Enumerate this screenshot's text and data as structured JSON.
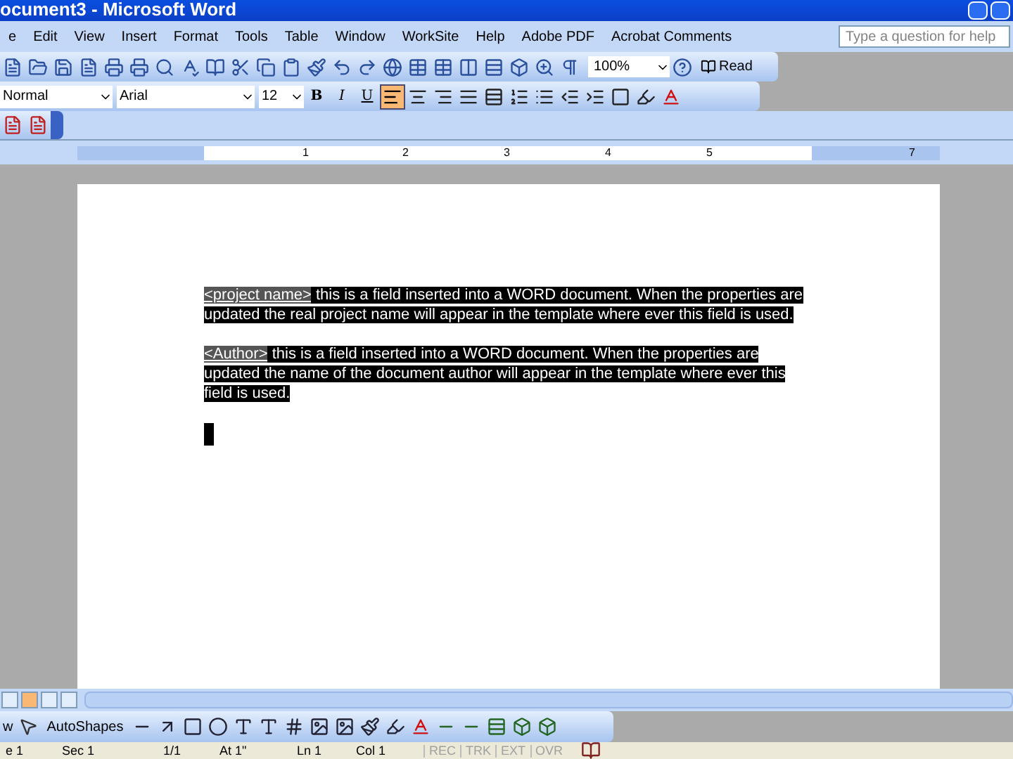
{
  "window": {
    "title": "ocument3 - Microsoft Word"
  },
  "menu": [
    "e",
    "Edit",
    "View",
    "Insert",
    "Format",
    "Tools",
    "Table",
    "Window",
    "WorkSite",
    "Help",
    "Adobe PDF",
    "Acrobat Comments"
  ],
  "help_search": {
    "placeholder": "Type a question for help"
  },
  "standard_toolbar": {
    "zoom": "100%",
    "read_button": "Read"
  },
  "formatting_toolbar": {
    "style": "Normal",
    "font": "Arial",
    "size": "12",
    "bold": "B",
    "italic": "I",
    "underline": "U",
    "align_left_selected": true
  },
  "ruler": {
    "ticks": [
      "1",
      "2",
      "3",
      "4",
      "5",
      "7"
    ]
  },
  "document": {
    "paragraphs": [
      {
        "field": "<project name>",
        "text": " this is a field inserted into a WORD document.  When the properties are updated the real project name will appear in the template where ever this field is used."
      },
      {
        "field": "<Author>",
        "text": " this is a field inserted into a WORD document.  When the properties are updated the name of the document author will appear in the template where ever this field is used."
      }
    ],
    "selected": true
  },
  "drawing_toolbar": {
    "draw": "w",
    "autoshapes": "AutoShapes"
  },
  "status_bar": {
    "cells": [
      "e 1",
      "Sec 1",
      "1/1",
      "At 1\"",
      "Ln 1",
      "Col 1"
    ],
    "modes": [
      {
        "label": "REC",
        "on": false
      },
      {
        "label": "TRK",
        "on": false
      },
      {
        "label": "EXT",
        "on": false
      },
      {
        "label": "OVR",
        "on": false
      }
    ]
  }
}
